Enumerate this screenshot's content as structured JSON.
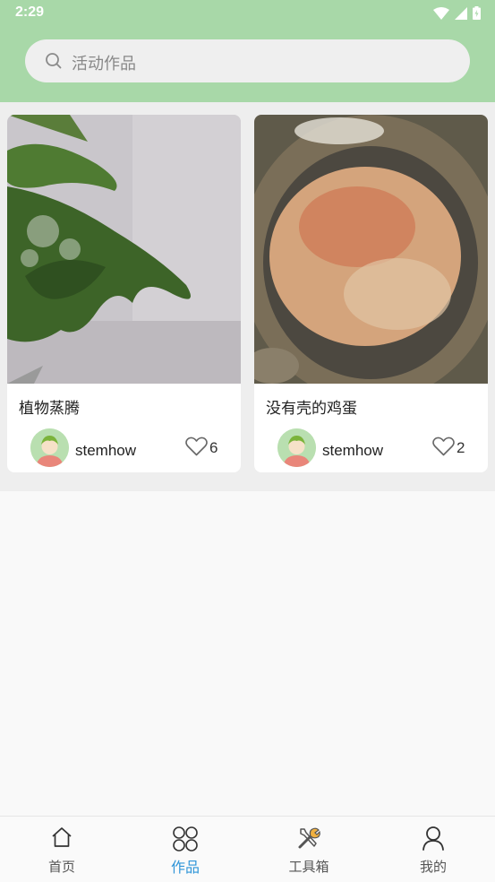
{
  "status_bar": {
    "time": "2:29"
  },
  "search": {
    "placeholder": "活动作品"
  },
  "works": [
    {
      "title": "植物蒸腾",
      "author": "stemhow",
      "likes": "6"
    },
    {
      "title": "没有壳的鸡蛋",
      "author": "stemhow",
      "likes": "2"
    }
  ],
  "nav": {
    "items": [
      {
        "label": "首页",
        "icon": "home-icon"
      },
      {
        "label": "作品",
        "icon": "works-grid-icon",
        "active": true
      },
      {
        "label": "工具箱",
        "icon": "toolbox-icon"
      },
      {
        "label": "我的",
        "icon": "profile-icon"
      }
    ]
  },
  "colors": {
    "header": "#a8d8a8",
    "accent": "#2f95d8"
  }
}
